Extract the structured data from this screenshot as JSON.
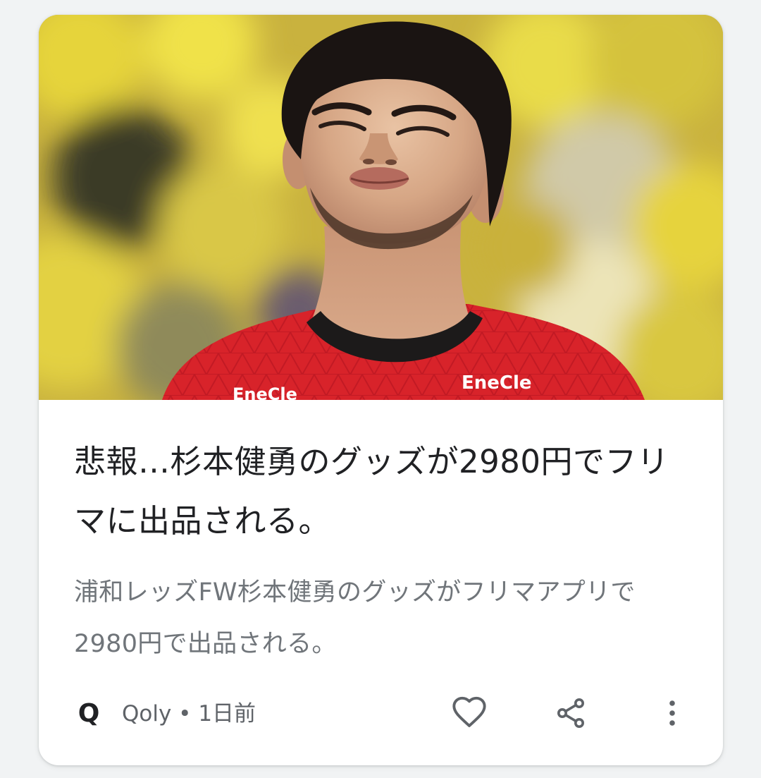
{
  "card": {
    "image_alt": "",
    "headline": "悲報…杉本健勇のグッズが2980円でフリマに出品される。",
    "snippet": "浦和レッズFW杉本健勇のグッズがフリマアプリで2980円で出品される。",
    "jersey_sponsor": "EneCle",
    "source": {
      "logo_letter": "Q",
      "name": "Qoly",
      "separator": " • ",
      "age": "1日前"
    },
    "actions": {
      "like_icon": "heart-outline-icon",
      "share_icon": "share-icon",
      "more_icon": "more-vert-icon"
    }
  },
  "colors": {
    "background": "#f1f3f4",
    "card": "#ffffff",
    "headline": "#202124",
    "snippet": "#70757a",
    "meta": "#5f6368"
  }
}
